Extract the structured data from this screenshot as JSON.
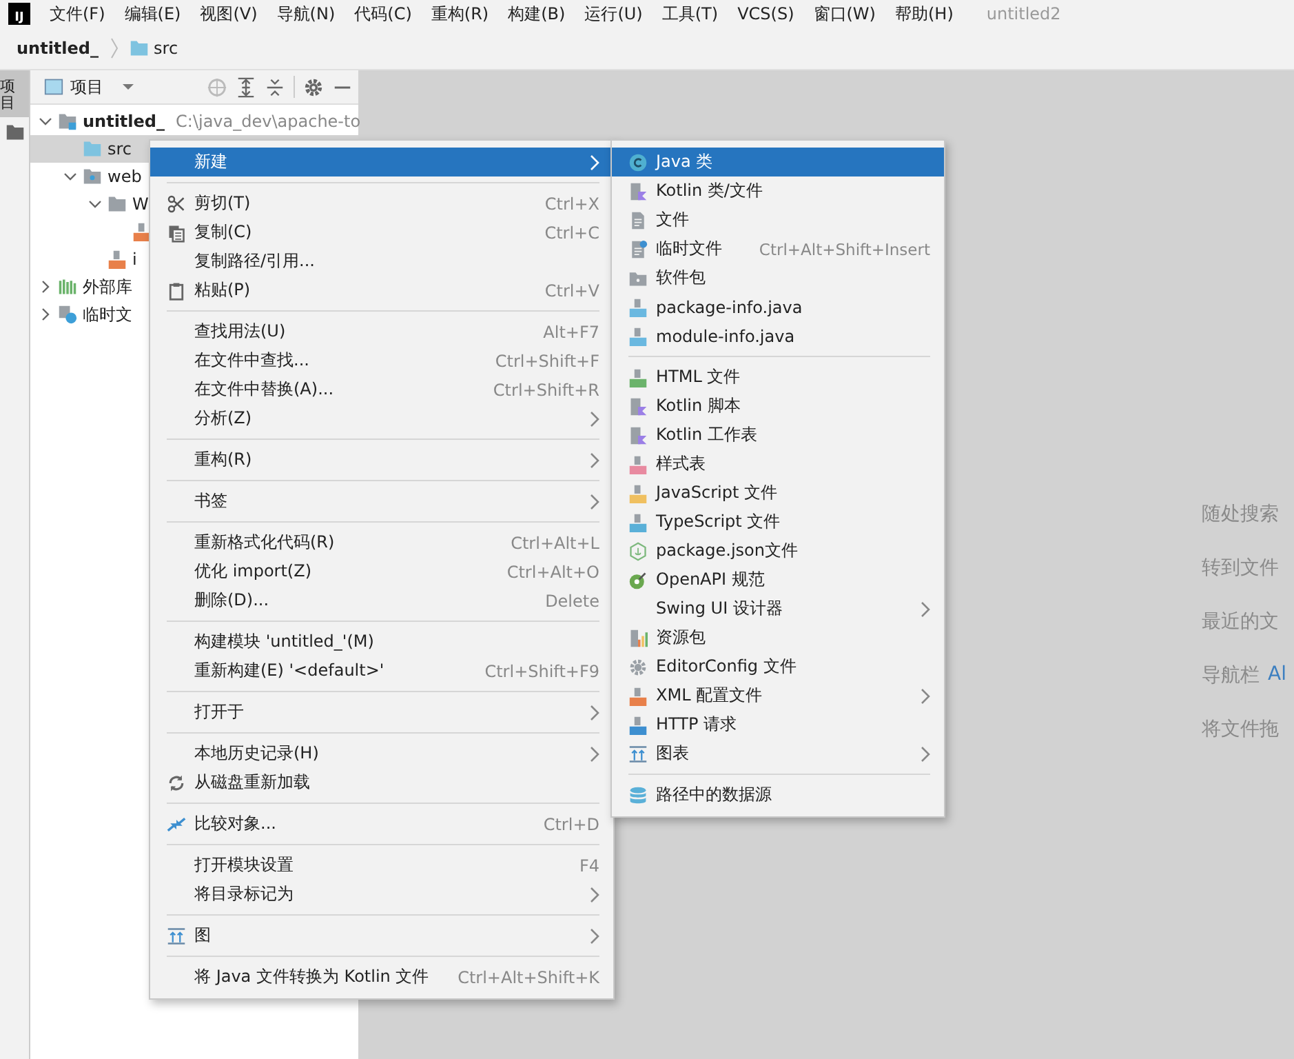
{
  "menubar": {
    "logo": "IJ",
    "menus": [
      "文件(F)",
      "编辑(E)",
      "视图(V)",
      "导航(N)",
      "代码(C)",
      "重构(R)",
      "构建(B)",
      "运行(U)",
      "工具(T)",
      "VCS(S)",
      "窗口(W)",
      "帮助(H)"
    ],
    "project_title": "untitled2"
  },
  "breadcrumb": [
    {
      "label": "untitled_",
      "kind": "project"
    },
    {
      "label": "src",
      "kind": "folder"
    }
  ],
  "side_tab": {
    "label": "项目",
    "selected": true
  },
  "project_panel": {
    "view": "项目",
    "tree": [
      {
        "label": "untitled_",
        "path": "C:\\java_dev\\apache-to",
        "kind": "module",
        "expanded": true,
        "selected": false,
        "children": [
          {
            "label": "src",
            "kind": "folder",
            "selected": true
          },
          {
            "label": "web",
            "kind": "webfolder",
            "expanded": true,
            "selected": false,
            "children": [
              {
                "label": "W",
                "kind": "folder",
                "expanded": true,
                "selected": false,
                "children": [
                  {
                    "kind": "xmlfile",
                    "selected": false
                  }
                ]
              },
              {
                "label": "i",
                "kind": "jsp",
                "selected": false
              }
            ]
          }
        ]
      },
      {
        "label": "外部库",
        "kind": "library",
        "expanded": false,
        "selected": false
      },
      {
        "label": "临时文",
        "kind": "scratch",
        "expanded": false,
        "selected": false
      }
    ]
  },
  "context_menu": [
    [
      {
        "label": "新建",
        "kind": "none",
        "submenu": true,
        "selected": true
      }
    ],
    [
      {
        "label": "剪切(T)",
        "kind": "cut",
        "shortcut": "Ctrl+X",
        "selected": false
      },
      {
        "label": "复制(C)",
        "kind": "copy",
        "shortcut": "Ctrl+C",
        "selected": false
      },
      {
        "label": "复制路径/引用...",
        "kind": "none",
        "selected": false
      },
      {
        "label": "粘贴(P)",
        "kind": "paste",
        "shortcut": "Ctrl+V",
        "selected": false
      }
    ],
    [
      {
        "label": "查找用法(U)",
        "kind": "none",
        "shortcut": "Alt+F7",
        "selected": false
      },
      {
        "label": "在文件中查找...",
        "kind": "none",
        "shortcut": "Ctrl+Shift+F",
        "selected": false
      },
      {
        "label": "在文件中替换(A)...",
        "kind": "none",
        "shortcut": "Ctrl+Shift+R",
        "selected": false
      },
      {
        "label": "分析(Z)",
        "kind": "none",
        "submenu": true,
        "selected": false
      }
    ],
    [
      {
        "label": "重构(R)",
        "kind": "none",
        "submenu": true,
        "selected": false
      }
    ],
    [
      {
        "label": "书签",
        "kind": "none",
        "submenu": true,
        "selected": false
      }
    ],
    [
      {
        "label": "重新格式化代码(R)",
        "kind": "none",
        "shortcut": "Ctrl+Alt+L",
        "selected": false
      },
      {
        "label": "优化 import(Z)",
        "kind": "none",
        "shortcut": "Ctrl+Alt+O",
        "selected": false
      },
      {
        "label": "删除(D)...",
        "kind": "none",
        "shortcut": "Delete",
        "selected": false
      }
    ],
    [
      {
        "label": "构建模块 'untitled_'(M)",
        "kind": "none",
        "selected": false
      },
      {
        "label": "重新构建(E) '<default>'",
        "kind": "none",
        "shortcut": "Ctrl+Shift+F9",
        "selected": false
      }
    ],
    [
      {
        "label": "打开于",
        "kind": "none",
        "submenu": true,
        "selected": false
      }
    ],
    [
      {
        "label": "本地历史记录(H)",
        "kind": "none",
        "submenu": true,
        "selected": false
      },
      {
        "label": "从磁盘重新加载",
        "kind": "reload",
        "selected": false
      }
    ],
    [
      {
        "label": "比较对象...",
        "kind": "compare",
        "shortcut": "Ctrl+D",
        "selected": false
      }
    ],
    [
      {
        "label": "打开模块设置",
        "kind": "none",
        "shortcut": "F4",
        "selected": false
      },
      {
        "label": "将目录标记为",
        "kind": "none",
        "submenu": true,
        "selected": false
      }
    ],
    [
      {
        "label": "图",
        "kind": "diagram",
        "submenu": true,
        "selected": false
      }
    ],
    [
      {
        "label": "将 Java 文件转换为 Kotlin 文件",
        "kind": "none",
        "shortcut": "Ctrl+Alt+Shift+K",
        "selected": false
      }
    ]
  ],
  "new_submenu": [
    [
      {
        "label": "Java 类",
        "kind": "class",
        "selected": true
      },
      {
        "label": "Kotlin 类/文件",
        "kind": "kotlin",
        "selected": false
      },
      {
        "label": "文件",
        "kind": "file",
        "selected": false
      },
      {
        "label": "临时文件",
        "kind": "scratchfile",
        "shortcut": "Ctrl+Alt+Shift+Insert",
        "selected": false
      },
      {
        "label": "软件包",
        "kind": "package",
        "selected": false
      },
      {
        "label": "package-info.java",
        "kind": "javafile",
        "selected": false
      },
      {
        "label": "module-info.java",
        "kind": "javafile",
        "selected": false
      }
    ],
    [
      {
        "label": "HTML 文件",
        "kind": "html",
        "selected": false
      },
      {
        "label": "Kotlin 脚本",
        "kind": "kotlin",
        "selected": false
      },
      {
        "label": "Kotlin 工作表",
        "kind": "kotlin",
        "selected": false
      },
      {
        "label": "样式表",
        "kind": "css",
        "selected": false
      },
      {
        "label": "JavaScript 文件",
        "kind": "js",
        "selected": false
      },
      {
        "label": "TypeScript 文件",
        "kind": "ts",
        "selected": false
      },
      {
        "label": "package.json文件",
        "kind": "node",
        "selected": false
      },
      {
        "label": "OpenAPI 规范",
        "kind": "openapi",
        "selected": false
      },
      {
        "label": "Swing UI 设计器",
        "kind": "none",
        "submenu": true,
        "selected": false
      },
      {
        "label": "资源包",
        "kind": "bundle",
        "selected": false
      },
      {
        "label": "EditorConfig 文件",
        "kind": "gear",
        "selected": false
      },
      {
        "label": "XML 配置文件",
        "kind": "xml",
        "submenu": true,
        "selected": false
      },
      {
        "label": "HTTP 请求",
        "kind": "api",
        "selected": false
      },
      {
        "label": "图表",
        "kind": "diagram",
        "submenu": true,
        "selected": false
      }
    ],
    [
      {
        "label": "路径中的数据源",
        "kind": "database",
        "selected": false
      }
    ]
  ],
  "hints": [
    {
      "label": "随处搜索"
    },
    {
      "label": "转到文件"
    },
    {
      "label": "最近的文"
    },
    {
      "label": "导航栏",
      "shortcut": "Al"
    },
    {
      "label": "将文件拖"
    }
  ]
}
